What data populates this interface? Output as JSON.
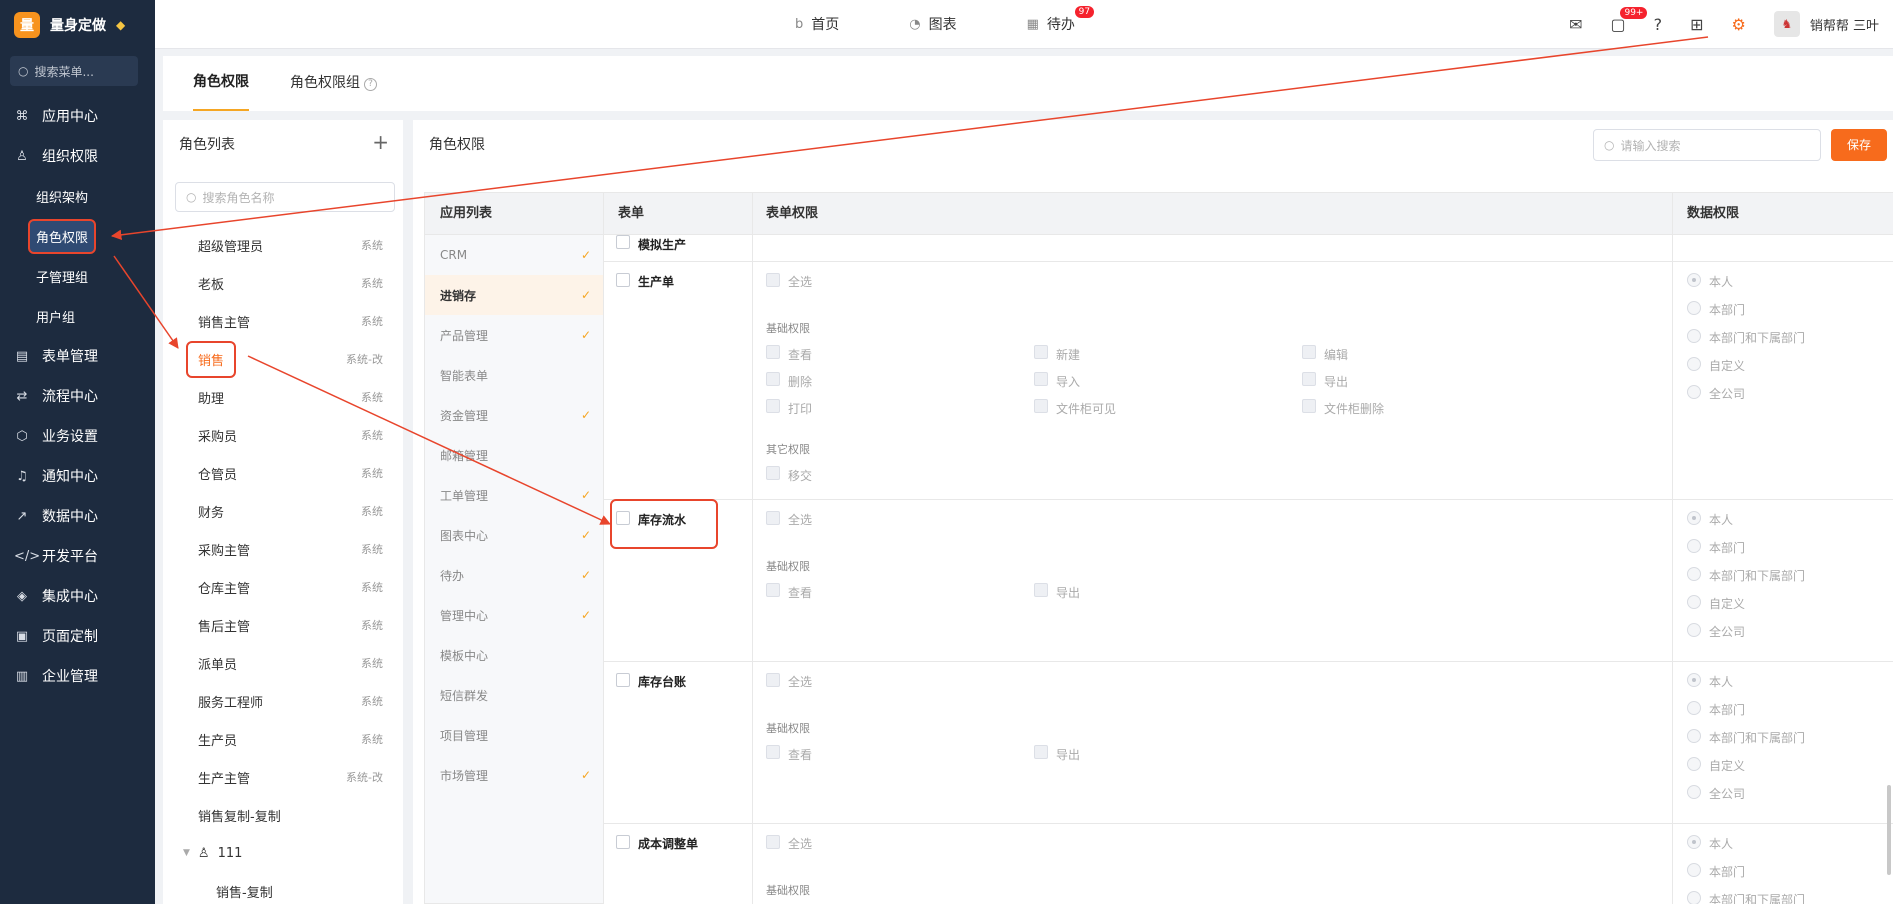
{
  "app": {
    "logo": "量",
    "name": "量身定做"
  },
  "sidebar": {
    "search_placeholder": "搜索菜单...",
    "items": [
      {
        "label": "应用中心",
        "icon": "⌘"
      },
      {
        "label": "组织权限",
        "icon": "♙"
      },
      {
        "label": "表单管理",
        "icon": "▤"
      },
      {
        "label": "流程中心",
        "icon": "⇄"
      },
      {
        "label": "业务设置",
        "icon": "⬡"
      },
      {
        "label": "通知中心",
        "icon": "♫"
      },
      {
        "label": "数据中心",
        "icon": "↗"
      },
      {
        "label": "开发平台",
        "icon": "</>"
      },
      {
        "label": "集成中心",
        "icon": "◈"
      },
      {
        "label": "页面定制",
        "icon": "▣"
      },
      {
        "label": "企业管理",
        "icon": "▥"
      }
    ],
    "sub_items": [
      "组织架构",
      "角色权限",
      "子管理组",
      "用户组"
    ]
  },
  "topnav": {
    "home": "首页",
    "charts": "图表",
    "todo": "待办",
    "todo_badge": "97"
  },
  "topright": {
    "msg_badge": "99+",
    "user": "销帮帮 三叶"
  },
  "tabs": {
    "active": "角色权限",
    "other": "角色权限组"
  },
  "role_panel": {
    "title": "角色列表",
    "search_placeholder": "搜索角色名称",
    "roles": [
      {
        "name": "超级管理员",
        "tag": "系统"
      },
      {
        "name": "老板",
        "tag": "系统"
      },
      {
        "name": "销售主管",
        "tag": "系统"
      },
      {
        "name": "销售",
        "tag": "系统-改"
      },
      {
        "name": "助理",
        "tag": "系统"
      },
      {
        "name": "采购员",
        "tag": "系统"
      },
      {
        "name": "仓管员",
        "tag": "系统"
      },
      {
        "name": "财务",
        "tag": "系统"
      },
      {
        "name": "采购主管",
        "tag": "系统"
      },
      {
        "name": "仓库主管",
        "tag": "系统"
      },
      {
        "name": "售后主管",
        "tag": "系统"
      },
      {
        "name": "派单员",
        "tag": "系统"
      },
      {
        "name": "服务工程师",
        "tag": "系统"
      },
      {
        "name": "生产员",
        "tag": "系统"
      },
      {
        "name": "生产主管",
        "tag": "系统-改"
      },
      {
        "name": "销售复制-复制",
        "tag": ""
      }
    ],
    "group": {
      "name": "111",
      "child": "销售-复制"
    }
  },
  "main": {
    "title": "角色权限",
    "search_placeholder": "请输入搜索",
    "save": "保存",
    "applist_header": "应用列表",
    "apps": [
      {
        "name": "CRM",
        "checked": true
      },
      {
        "name": "进销存",
        "checked": true
      },
      {
        "name": "产品管理",
        "checked": true
      },
      {
        "name": "智能表单",
        "checked": false
      },
      {
        "name": "资金管理",
        "checked": true
      },
      {
        "name": "邮箱管理",
        "checked": false
      },
      {
        "name": "工单管理",
        "checked": true
      },
      {
        "name": "图表中心",
        "checked": true
      },
      {
        "name": "待办",
        "checked": true
      },
      {
        "name": "管理中心",
        "checked": true
      },
      {
        "name": "模板中心",
        "checked": false
      },
      {
        "name": "短信群发",
        "checked": false
      },
      {
        "name": "项目管理",
        "checked": false
      },
      {
        "name": "市场管理",
        "checked": true
      }
    ],
    "columns": {
      "form": "表单",
      "form_perm": "表单权限",
      "data_perm": "数据权限"
    },
    "labels": {
      "select_all": "全选",
      "basic": "基础权限",
      "other": "其它权限",
      "view": "查看",
      "create": "新建",
      "edit": "编辑",
      "delete": "删除",
      "import": "导入",
      "export": "导出",
      "print": "打印",
      "file_visible": "文件柜可见",
      "file_delete": "文件柜删除",
      "transfer": "移交"
    },
    "data_scopes": [
      "本人",
      "本部门",
      "本部门和下属部门",
      "自定义",
      "全公司"
    ],
    "forms": [
      "模拟生产",
      "生产单",
      "库存流水",
      "库存台账",
      "成本调整单"
    ]
  }
}
